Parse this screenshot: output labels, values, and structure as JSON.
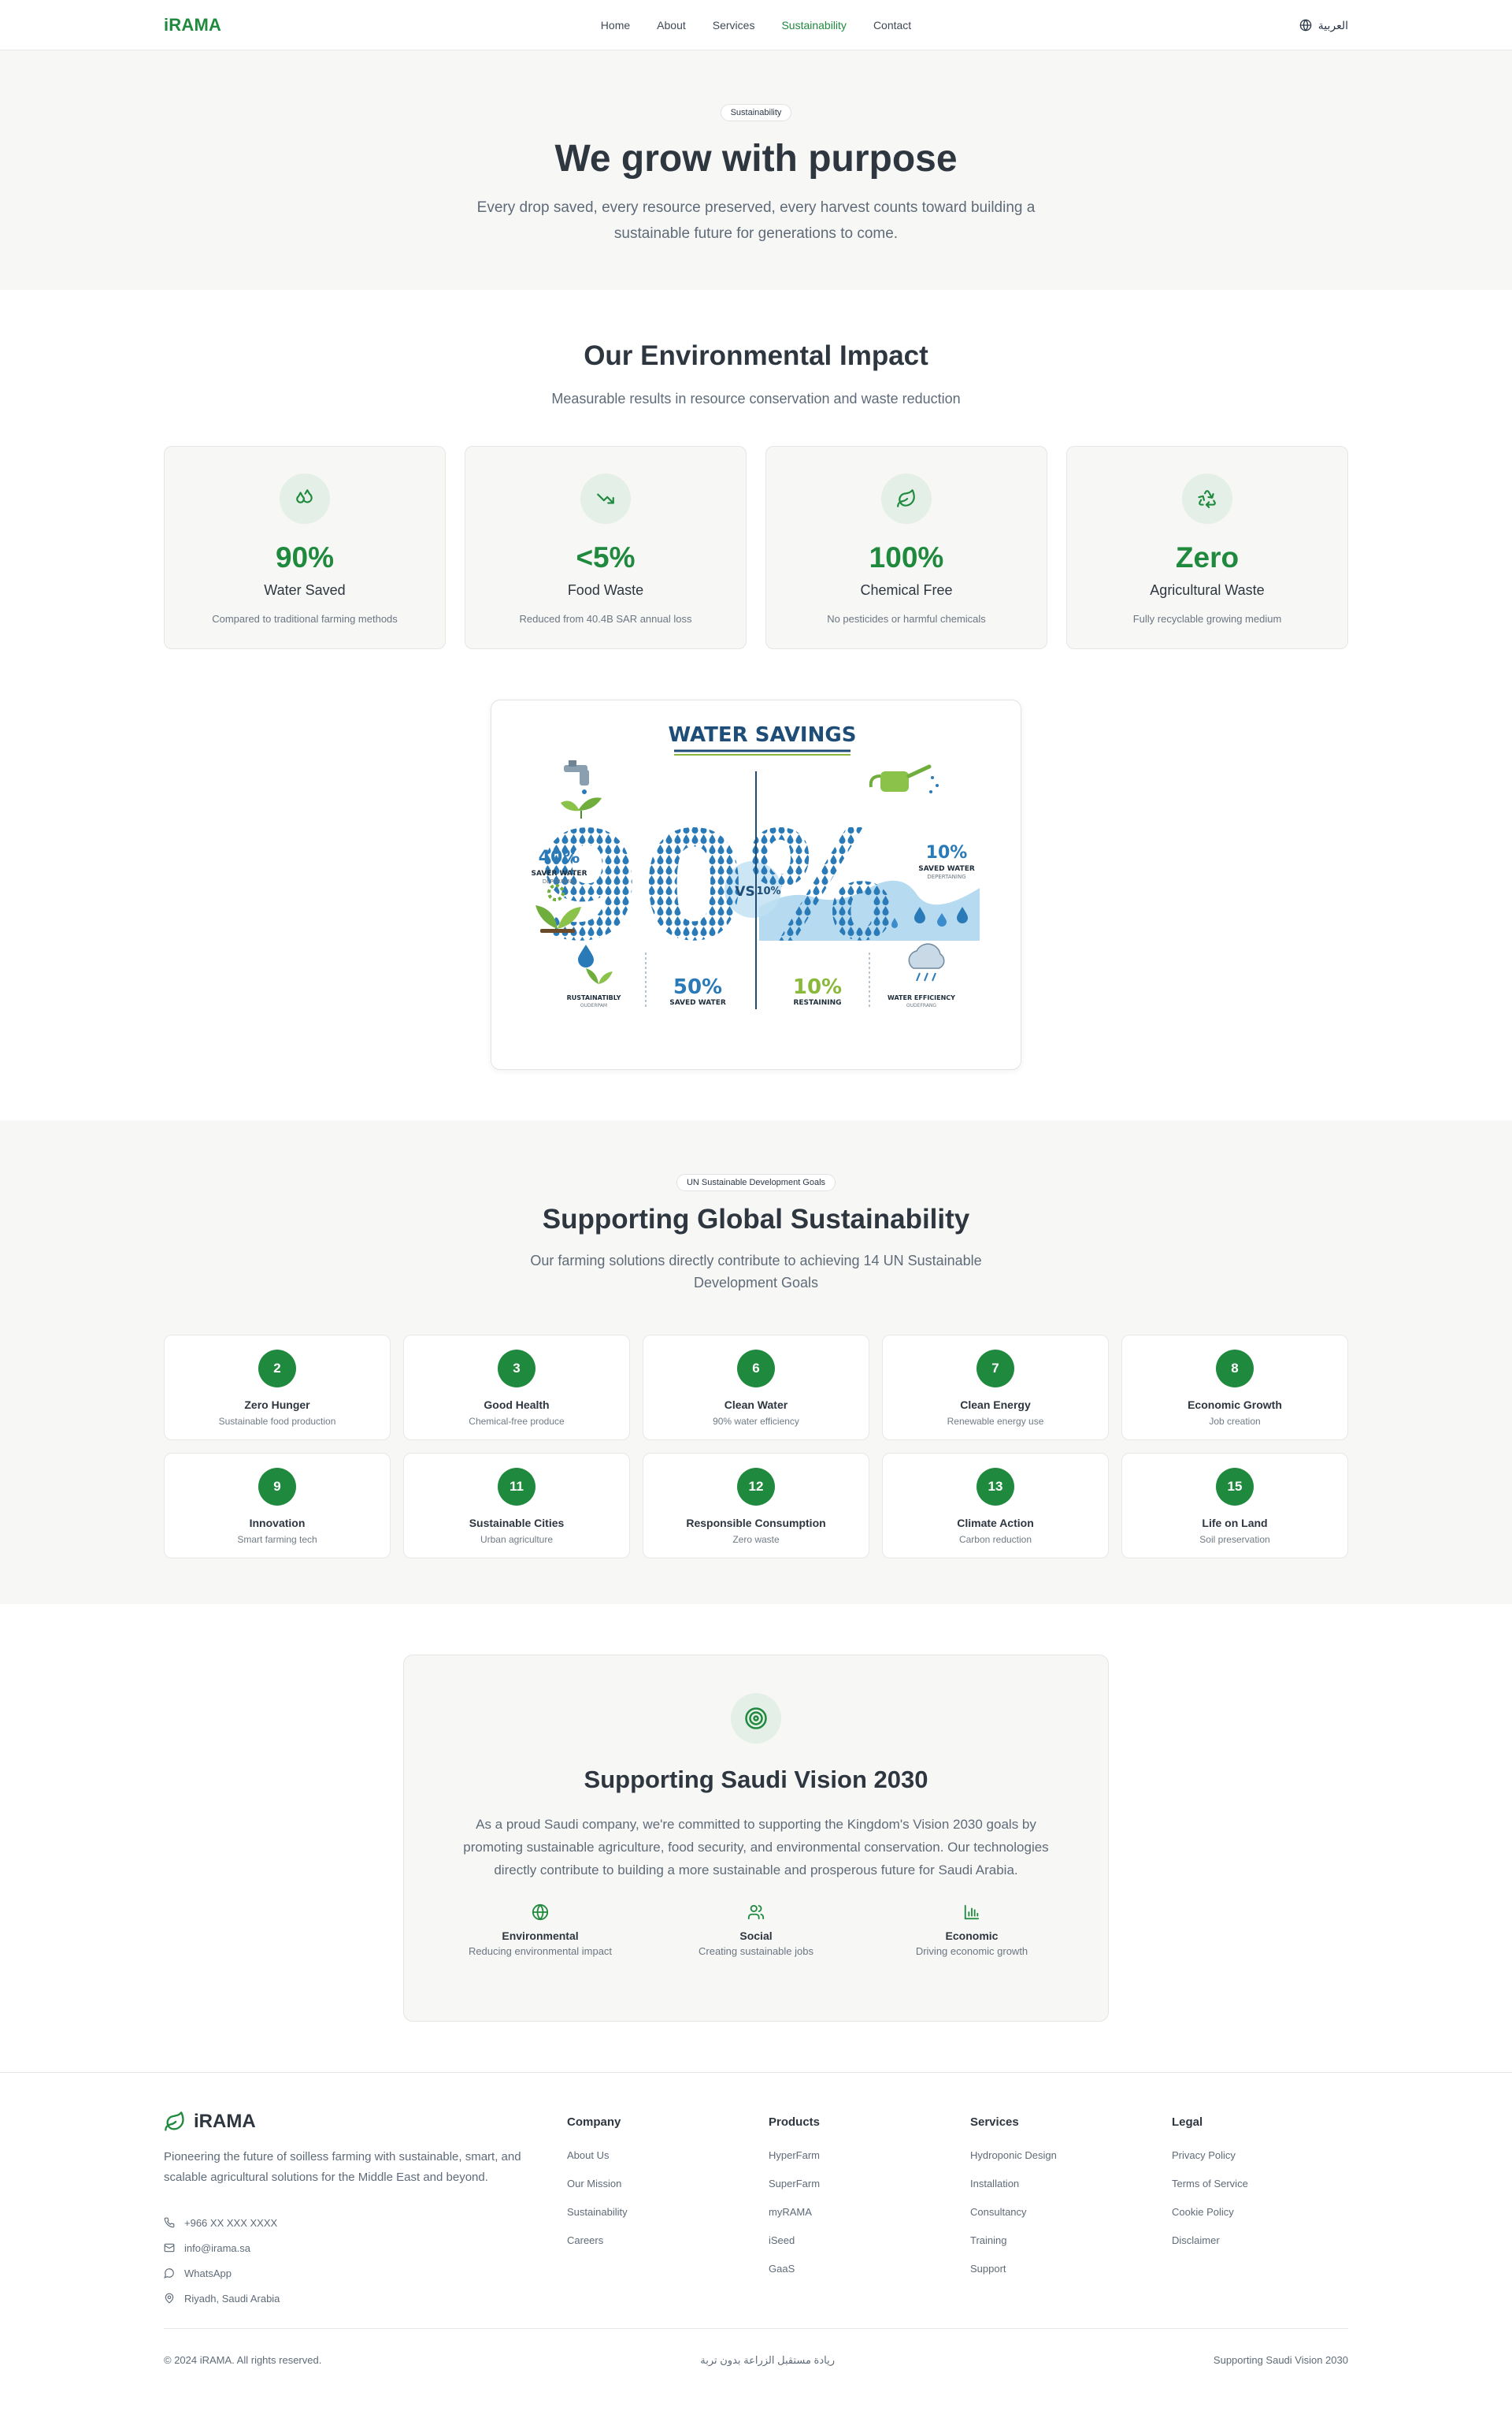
{
  "nav": {
    "logo": "iRAMA",
    "links": [
      "Home",
      "About",
      "Services",
      "Sustainability",
      "Contact"
    ],
    "active": "Sustainability",
    "language": "العربية"
  },
  "hero": {
    "badge": "Sustainability",
    "title": "We grow with purpose",
    "subtitle": "Every drop saved, every resource preserved, every harvest counts toward building a sustainable future for generations to come."
  },
  "impact": {
    "title": "Our Environmental Impact",
    "subtitle": "Measurable results in resource conservation and waste reduction",
    "stats": [
      {
        "icon": "droplets-icon",
        "value": "90%",
        "label": "Water Saved",
        "desc": "Compared to traditional farming methods"
      },
      {
        "icon": "trending-down-icon",
        "value": "<5%",
        "label": "Food Waste",
        "desc": "Reduced from 40.4B SAR annual loss"
      },
      {
        "icon": "leaf-icon",
        "value": "100%",
        "label": "Chemical Free",
        "desc": "No pesticides or harmful chemicals"
      },
      {
        "icon": "recycle-icon",
        "value": "Zero",
        "label": "Agricultural Waste",
        "desc": "Fully recyclable growing medium"
      }
    ]
  },
  "infographic": {
    "title": "WATER SAVINGS",
    "big_value": "90%",
    "vs_label": "VS",
    "vs_value": "10%",
    "left_value": "40%",
    "left_label": "SAVER WATER",
    "left_sub": "DEPERPANG",
    "right_value": "10%",
    "right_label": "SAVED WATER",
    "right_sub": "DEPERTANING",
    "b1_label": "RUSTAINATIBLY",
    "b1_sub": "OUDERPAM",
    "b2_value": "50%",
    "b2_label": "SAVED WATER",
    "b3_value": "10%",
    "b3_label": "RESTAINING",
    "b4_label": "WATER EFFICIENCY",
    "b4_sub": "OUDEFRANG"
  },
  "sdg": {
    "badge": "UN Sustainable Development Goals",
    "title": "Supporting Global Sustainability",
    "subtitle": "Our farming solutions directly contribute to achieving 14 UN Sustainable Development Goals",
    "goals": [
      {
        "num": "2",
        "name": "Zero Hunger",
        "desc": "Sustainable food production"
      },
      {
        "num": "3",
        "name": "Good Health",
        "desc": "Chemical-free produce"
      },
      {
        "num": "6",
        "name": "Clean Water",
        "desc": "90% water efficiency"
      },
      {
        "num": "7",
        "name": "Clean Energy",
        "desc": "Renewable energy use"
      },
      {
        "num": "8",
        "name": "Economic Growth",
        "desc": "Job creation"
      },
      {
        "num": "9",
        "name": "Innovation",
        "desc": "Smart farming tech"
      },
      {
        "num": "11",
        "name": "Sustainable Cities",
        "desc": "Urban agriculture"
      },
      {
        "num": "12",
        "name": "Responsible Consumption",
        "desc": "Zero waste"
      },
      {
        "num": "13",
        "name": "Climate Action",
        "desc": "Carbon reduction"
      },
      {
        "num": "15",
        "name": "Life on Land",
        "desc": "Soil preservation"
      }
    ]
  },
  "vision": {
    "title": "Supporting Saudi Vision 2030",
    "body": "As a proud Saudi company, we're committed to supporting the Kingdom's Vision 2030 goals by promoting sustainable agriculture, food security, and environmental conservation. Our technologies directly contribute to building a more sustainable and prosperous future for Saudi Arabia.",
    "pillars": [
      {
        "icon": "globe-icon",
        "name": "Environmental",
        "desc": "Reducing environmental impact"
      },
      {
        "icon": "users-icon",
        "name": "Social",
        "desc": "Creating sustainable jobs"
      },
      {
        "icon": "bar-chart-icon",
        "name": "Economic",
        "desc": "Driving economic growth"
      }
    ]
  },
  "footer": {
    "brand": "iRAMA",
    "tagline": "Pioneering the future of soilless farming with sustainable, smart, and scalable agricultural solutions for the Middle East and beyond.",
    "contact": {
      "phone": "+966 XX XXX XXXX",
      "email": "info@irama.sa",
      "whatsapp": "WhatsApp",
      "location": "Riyadh, Saudi Arabia"
    },
    "columns": [
      {
        "title": "Company",
        "links": [
          "About Us",
          "Our Mission",
          "Sustainability",
          "Careers"
        ]
      },
      {
        "title": "Products",
        "links": [
          "HyperFarm",
          "SuperFarm",
          "myRAMA",
          "iSeed",
          "GaaS"
        ]
      },
      {
        "title": "Services",
        "links": [
          "Hydroponic Design",
          "Installation",
          "Consultancy",
          "Training",
          "Support"
        ]
      },
      {
        "title": "Legal",
        "links": [
          "Privacy Policy",
          "Terms of Service",
          "Cookie Policy",
          "Disclaimer"
        ]
      }
    ],
    "copyright": "© 2024 iRAMA. All rights reserved.",
    "arabic_tagline": "ريادة مستقبل الزراعة بدون تربة",
    "vision_note": "Supporting Saudi Vision 2030"
  },
  "colors": {
    "brand_green": "#1f8a3e",
    "water_blue": "#2a7ab8",
    "lime": "#8ab83a"
  }
}
